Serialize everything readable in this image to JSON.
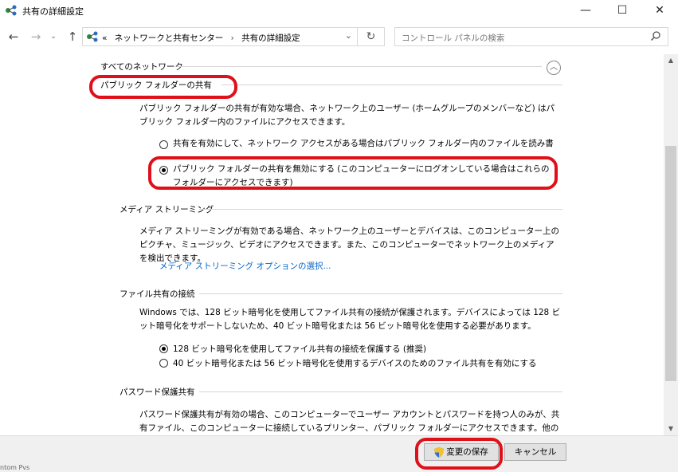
{
  "window": {
    "title": "共有の詳細設定",
    "min_glyph": "—",
    "max_glyph": "☐",
    "close_glyph": "✕"
  },
  "nav": {
    "back_glyph": "←",
    "forward_glyph": "→",
    "recent_glyph": "⌄",
    "up_glyph": "↑",
    "overflow": "«",
    "breadcrumb": [
      "ネットワークと共有センター",
      "共有の詳細設定"
    ],
    "breadcrumb_sep": "›",
    "dropdown_glyph": "⌄",
    "refresh_glyph": "↻",
    "search_placeholder": "コントロール パネルの検索"
  },
  "content": {
    "section_title": "すべてのネットワーク",
    "collapse_glyph": "︿",
    "public_folder": {
      "heading": "パブリック フォルダーの共有",
      "description": "パブリック フォルダーの共有が有効な場合、ネットワーク上のユーザー (ホームグループのメンバーなど) はパブリック フォルダー内のファイルにアクセスできます。",
      "option_on": "共有を有効にして、ネットワーク アクセスがある場合はパブリック フォルダー内のファイルを読み書きできるようにする",
      "option_off": "パブリック フォルダーの共有を無効にする (このコンピューターにログオンしている場合はこれらのフォルダーにアクセスできます)",
      "selected": "off"
    },
    "media_streaming": {
      "heading": "メディア ストリーミング",
      "description": "メディア ストリーミングが有効である場合、ネットワーク上のユーザーとデバイスは、このコンピューター上のピクチャ、ミュージック、ビデオにアクセスできます。また、このコンピューターでネットワーク上のメディアを検出できます。",
      "link": "メディア ストリーミング オプションの選択..."
    },
    "file_sharing": {
      "heading": "ファイル共有の接続",
      "description": "Windows では、128 ビット暗号化を使用してファイル共有の接続が保護されます。デバイスによっては 128 ビット暗号化をサポートしないため、40 ビット暗号化または 56 ビット暗号化を使用する必要があります。",
      "option_128": "128 ビット暗号化を使用してファイル共有の接続を保護する (推奨)",
      "option_40": "40 ビット暗号化または 56 ビット暗号化を使用するデバイスのためのファイル共有を有効にする",
      "selected": "128"
    },
    "password_sharing": {
      "heading": "パスワード保護共有",
      "description": "パスワード保護共有が有効の場合、このコンピューターでユーザー アカウントとパスワードを持つ人のみが、共有ファイル、このコンピューターに接続しているプリンター、パブリック フォルダーにアクセスできます。他の人がアクセスできるようにするには、パスワード保護共有を無効にする必要があります。"
    }
  },
  "footer": {
    "save_label": "変更の保存",
    "cancel_label": "キャンセル"
  },
  "scrollbar": {
    "up_glyph": "▲",
    "down_glyph": "▼"
  },
  "taskbar_peek": "ntom Pvs",
  "colors": {
    "link": "#0066cc",
    "annotation_red": "#e0101a",
    "button_face": "#e1e1e1",
    "footer_bg": "#f0f0f0"
  }
}
